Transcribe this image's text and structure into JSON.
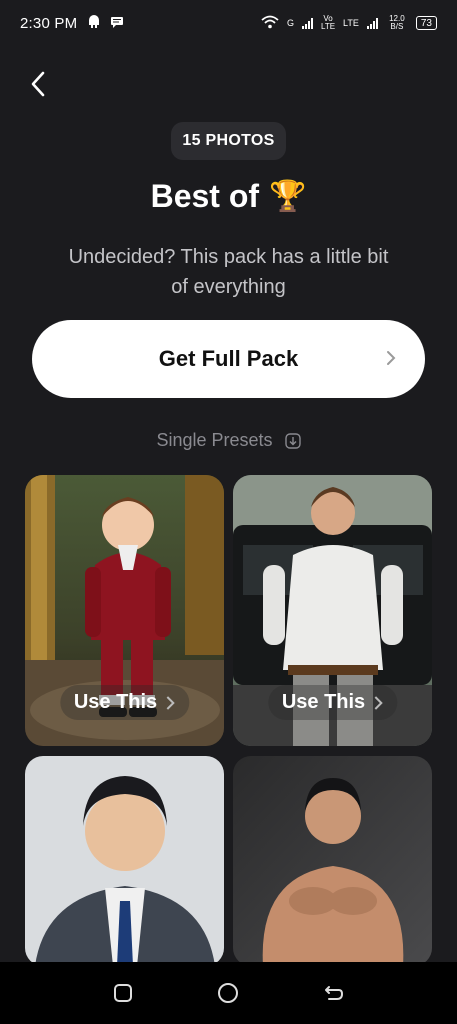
{
  "status": {
    "time": "2:30 PM",
    "network_label": "G",
    "volte_label": "Vo LTE",
    "lte_label": "LTE",
    "speed_label": "12.0 B/S",
    "battery": "73"
  },
  "header": {
    "badge": "15 PHOTOS",
    "title": "Best of",
    "title_emoji": "🏆",
    "subtitle": "Undecided? This pack has a little bit of everything"
  },
  "actions": {
    "full_pack": "Get Full Pack"
  },
  "presets": {
    "label": "Single Presets",
    "cards": [
      {
        "cta": "Use This"
      },
      {
        "cta": "Use This"
      },
      {
        "cta": ""
      },
      {
        "cta": ""
      }
    ]
  },
  "colors": {
    "background": "#1b1b1e",
    "button_bg": "#ffffff",
    "muted_text": "#8a8a90"
  }
}
